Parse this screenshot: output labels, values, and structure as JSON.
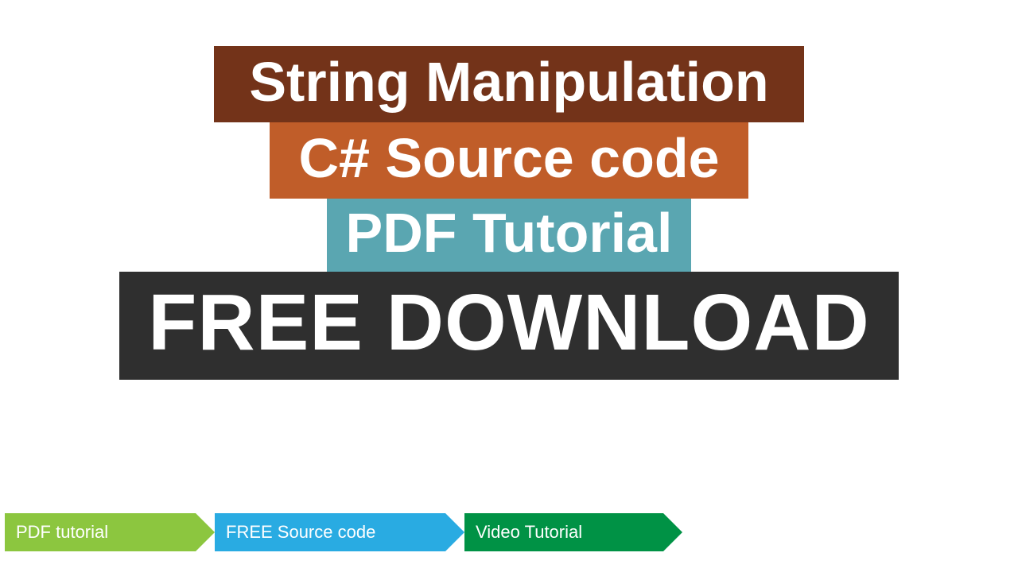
{
  "banners": {
    "line1": "String Manipulation",
    "line2": "C# Source code",
    "line3": "PDF Tutorial",
    "line4": "FREE DOWNLOAD"
  },
  "arrows": {
    "item1": "PDF tutorial",
    "item2": "FREE Source code",
    "item3": "Video Tutorial"
  },
  "colors": {
    "banner1_bg": "#733319",
    "banner2_bg": "#C05D29",
    "banner3_bg": "#5AA6B1",
    "banner4_bg": "#2F2F2F",
    "arrow1_bg": "#8CC63F",
    "arrow2_bg": "#29ABE2",
    "arrow3_bg": "#009245"
  }
}
